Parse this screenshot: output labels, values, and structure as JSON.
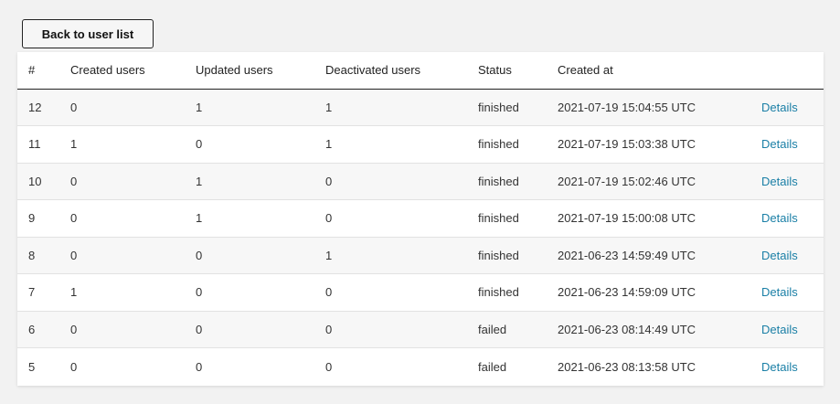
{
  "back_button_label": "Back to user list",
  "link_color": "#1a7fa6",
  "columns": {
    "num": "#",
    "created_users": "Created users",
    "updated_users": "Updated users",
    "deactivated_users": "Deactivated users",
    "status": "Status",
    "created_at": "Created at"
  },
  "rows": [
    {
      "num": "12",
      "created_users": "0",
      "updated_users": "1",
      "deactivated_users": "1",
      "status": "finished",
      "created_at": "2021-07-19 15:04:55 UTC",
      "details": "Details"
    },
    {
      "num": "11",
      "created_users": "1",
      "updated_users": "0",
      "deactivated_users": "1",
      "status": "finished",
      "created_at": "2021-07-19 15:03:38 UTC",
      "details": "Details"
    },
    {
      "num": "10",
      "created_users": "0",
      "updated_users": "1",
      "deactivated_users": "0",
      "status": "finished",
      "created_at": "2021-07-19 15:02:46 UTC",
      "details": "Details"
    },
    {
      "num": "9",
      "created_users": "0",
      "updated_users": "1",
      "deactivated_users": "0",
      "status": "finished",
      "created_at": "2021-07-19 15:00:08 UTC",
      "details": "Details"
    },
    {
      "num": "8",
      "created_users": "0",
      "updated_users": "0",
      "deactivated_users": "1",
      "status": "finished",
      "created_at": "2021-06-23 14:59:49 UTC",
      "details": "Details"
    },
    {
      "num": "7",
      "created_users": "1",
      "updated_users": "0",
      "deactivated_users": "0",
      "status": "finished",
      "created_at": "2021-06-23 14:59:09 UTC",
      "details": "Details"
    },
    {
      "num": "6",
      "created_users": "0",
      "updated_users": "0",
      "deactivated_users": "0",
      "status": "failed",
      "created_at": "2021-06-23 08:14:49 UTC",
      "details": "Details"
    },
    {
      "num": "5",
      "created_users": "0",
      "updated_users": "0",
      "deactivated_users": "0",
      "status": "failed",
      "created_at": "2021-06-23 08:13:58 UTC",
      "details": "Details"
    }
  ]
}
